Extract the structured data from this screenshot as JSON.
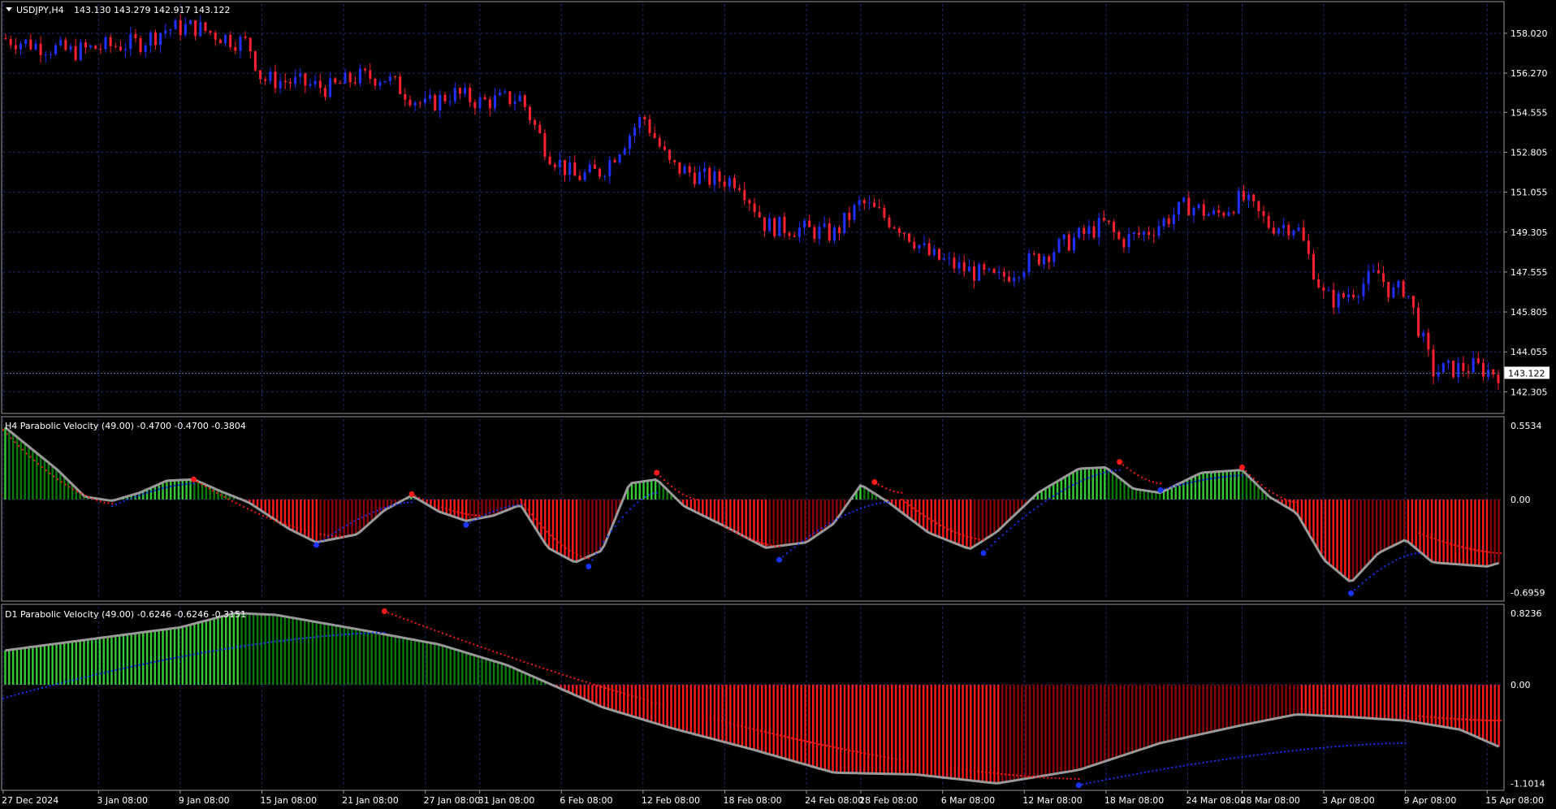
{
  "header": {
    "symbol": "USDJPY,H4",
    "ohlc": "143.130 143.279 142.917 143.122"
  },
  "colors": {
    "background": "#000000",
    "grid": "#1e2c6e",
    "bull_candle": "#2030ff",
    "bear_candle": "#ff2030",
    "hist_green_light": "#33cc33",
    "hist_green_dark": "#0a7a0a",
    "hist_red": "#ff1a1a",
    "hist_red_dark": "#8b0000",
    "velocity_line": "#999999",
    "sar_red": "#ff1a1a",
    "sar_blue": "#1a33ff",
    "price_box_bg": "#ffffff",
    "price_box_text": "#000000"
  },
  "chart_data": [
    {
      "type": "candlestick",
      "title": "USDJPY,H4",
      "ohlc_text": "143.130 143.279 142.917 143.122",
      "ylim": [
        141.5,
        159.3
      ],
      "y_ticks": [
        "158.020",
        "156.270",
        "154.555",
        "152.805",
        "151.055",
        "149.305",
        "147.555",
        "145.805",
        "144.055",
        "142.305"
      ],
      "y_tick_values": [
        158.02,
        156.27,
        154.555,
        152.805,
        151.055,
        149.305,
        147.555,
        145.805,
        144.055,
        142.305
      ],
      "current_price": "143.122",
      "current_price_value": 143.122,
      "close_path": [
        {
          "d": "2024-12-27",
          "v": 157.8
        },
        {
          "d": "2025-01-01",
          "v": 157.2
        },
        {
          "d": "2025-01-03",
          "v": 157.4
        },
        {
          "d": "2025-01-06",
          "v": 157.6
        },
        {
          "d": "2025-01-08",
          "v": 158.2
        },
        {
          "d": "2025-01-10",
          "v": 158.3
        },
        {
          "d": "2025-01-13",
          "v": 157.7
        },
        {
          "d": "2025-01-14",
          "v": 157.6
        },
        {
          "d": "2025-01-15",
          "v": 156.0
        },
        {
          "d": "2025-01-17",
          "v": 155.9
        },
        {
          "d": "2025-01-20",
          "v": 155.6
        },
        {
          "d": "2025-01-22",
          "v": 156.1
        },
        {
          "d": "2025-01-24",
          "v": 156.1
        },
        {
          "d": "2025-01-27",
          "v": 154.8
        },
        {
          "d": "2025-01-29",
          "v": 155.4
        },
        {
          "d": "2025-01-31",
          "v": 155.0
        },
        {
          "d": "2025-02-03",
          "v": 155.2
        },
        {
          "d": "2025-02-05",
          "v": 152.8
        },
        {
          "d": "2025-02-07",
          "v": 151.7
        },
        {
          "d": "2025-02-09",
          "v": 152.0
        },
        {
          "d": "2025-02-12",
          "v": 154.4
        },
        {
          "d": "2025-02-14",
          "v": 152.2
        },
        {
          "d": "2025-02-17",
          "v": 151.6
        },
        {
          "d": "2025-02-19",
          "v": 151.6
        },
        {
          "d": "2025-02-21",
          "v": 149.6
        },
        {
          "d": "2025-02-24",
          "v": 149.4
        },
        {
          "d": "2025-02-26",
          "v": 149.2
        },
        {
          "d": "2025-02-28",
          "v": 150.6
        },
        {
          "d": "2025-03-03",
          "v": 149.5
        },
        {
          "d": "2025-03-05",
          "v": 148.3
        },
        {
          "d": "2025-03-07",
          "v": 147.8
        },
        {
          "d": "2025-03-10",
          "v": 147.2
        },
        {
          "d": "2025-03-12",
          "v": 147.9
        },
        {
          "d": "2025-03-14",
          "v": 148.5
        },
        {
          "d": "2025-03-17",
          "v": 149.4
        },
        {
          "d": "2025-03-18",
          "v": 149.7
        },
        {
          "d": "2025-03-19",
          "v": 148.9
        },
        {
          "d": "2025-03-21",
          "v": 149.3
        },
        {
          "d": "2025-03-24",
          "v": 150.5
        },
        {
          "d": "2025-03-26",
          "v": 150.0
        },
        {
          "d": "2025-03-28",
          "v": 150.8
        },
        {
          "d": "2025-03-30",
          "v": 149.6
        },
        {
          "d": "2025-04-01",
          "v": 149.6
        },
        {
          "d": "2025-04-03",
          "v": 146.5
        },
        {
          "d": "2025-04-04",
          "v": 146.3
        },
        {
          "d": "2025-04-07",
          "v": 147.5
        },
        {
          "d": "2025-04-08",
          "v": 146.6
        },
        {
          "d": "2025-04-09",
          "v": 146.9
        },
        {
          "d": "2025-04-11",
          "v": 143.2
        },
        {
          "d": "2025-04-14",
          "v": 143.4
        },
        {
          "d": "2025-04-16",
          "v": 143.1
        }
      ]
    },
    {
      "type": "bar",
      "title": "H4 Parabolic Velocity (49.00) -0.4700 -0.4700 -0.3804",
      "ylim": [
        -0.74,
        0.6
      ],
      "y_ticks": [
        "0.5534",
        "0.00",
        "-0.6959"
      ],
      "y_tick_values": [
        0.5534,
        0,
        -0.6959
      ],
      "velocity": [
        {
          "d": "2024-12-27",
          "v": 0.55
        },
        {
          "d": "2024-12-31",
          "v": 0.22
        },
        {
          "d": "2025-01-02",
          "v": 0.02
        },
        {
          "d": "2025-01-04",
          "v": -0.01
        },
        {
          "d": "2025-01-06",
          "v": 0.05
        },
        {
          "d": "2025-01-08",
          "v": 0.14
        },
        {
          "d": "2025-01-10",
          "v": 0.15
        },
        {
          "d": "2025-01-12",
          "v": 0.06
        },
        {
          "d": "2025-01-14",
          "v": -0.02
        },
        {
          "d": "2025-01-17",
          "v": -0.22
        },
        {
          "d": "2025-01-19",
          "v": -0.32
        },
        {
          "d": "2025-01-22",
          "v": -0.26
        },
        {
          "d": "2025-01-24",
          "v": -0.08
        },
        {
          "d": "2025-01-26",
          "v": 0.03
        },
        {
          "d": "2025-01-28",
          "v": -0.09
        },
        {
          "d": "2025-01-30",
          "v": -0.16
        },
        {
          "d": "2025-02-01",
          "v": -0.12
        },
        {
          "d": "2025-02-03",
          "v": -0.04
        },
        {
          "d": "2025-02-05",
          "v": -0.36
        },
        {
          "d": "2025-02-07",
          "v": -0.47
        },
        {
          "d": "2025-02-09",
          "v": -0.38
        },
        {
          "d": "2025-02-11",
          "v": 0.12
        },
        {
          "d": "2025-02-13",
          "v": 0.15
        },
        {
          "d": "2025-02-15",
          "v": -0.05
        },
        {
          "d": "2025-02-18",
          "v": -0.2
        },
        {
          "d": "2025-02-21",
          "v": -0.36
        },
        {
          "d": "2025-02-24",
          "v": -0.32
        },
        {
          "d": "2025-02-26",
          "v": -0.18
        },
        {
          "d": "2025-02-28",
          "v": 0.11
        },
        {
          "d": "2025-03-02",
          "v": -0.02
        },
        {
          "d": "2025-03-05",
          "v": -0.25
        },
        {
          "d": "2025-03-08",
          "v": -0.37
        },
        {
          "d": "2025-03-10",
          "v": -0.24
        },
        {
          "d": "2025-03-13",
          "v": 0.05
        },
        {
          "d": "2025-03-16",
          "v": 0.23
        },
        {
          "d": "2025-03-18",
          "v": 0.24
        },
        {
          "d": "2025-03-20",
          "v": 0.08
        },
        {
          "d": "2025-03-22",
          "v": 0.05
        },
        {
          "d": "2025-03-25",
          "v": 0.2
        },
        {
          "d": "2025-03-28",
          "v": 0.22
        },
        {
          "d": "2025-03-30",
          "v": 0.02
        },
        {
          "d": "2025-04-01",
          "v": -0.1
        },
        {
          "d": "2025-04-03",
          "v": -0.45
        },
        {
          "d": "2025-04-05",
          "v": -0.62
        },
        {
          "d": "2025-04-07",
          "v": -0.4
        },
        {
          "d": "2025-04-09",
          "v": -0.3
        },
        {
          "d": "2025-04-11",
          "v": -0.47
        },
        {
          "d": "2025-04-15",
          "v": -0.5
        },
        {
          "d": "2025-04-16",
          "v": -0.47
        }
      ],
      "sar": [
        {
          "from": "2024-12-27",
          "to": "2025-01-04",
          "v0": 0.52,
          "v1": -0.03,
          "color": "red"
        },
        {
          "from": "2025-01-04",
          "to": "2025-01-10",
          "v0": -0.05,
          "v1": 0.12,
          "color": "blue"
        },
        {
          "from": "2025-01-10",
          "to": "2025-01-21",
          "v0": 0.15,
          "v1": -0.28,
          "color": "red"
        },
        {
          "from": "2025-01-19",
          "to": "2025-01-26",
          "v0": -0.34,
          "v1": -0.02,
          "color": "blue"
        },
        {
          "from": "2025-01-26",
          "to": "2025-01-31",
          "v0": 0.04,
          "v1": -0.12,
          "color": "red"
        },
        {
          "from": "2025-01-30",
          "to": "2025-02-03",
          "v0": -0.19,
          "v1": -0.04,
          "color": "blue"
        },
        {
          "from": "2025-02-03",
          "to": "2025-02-08",
          "v0": 0.0,
          "v1": -0.44,
          "color": "red"
        },
        {
          "from": "2025-02-08",
          "to": "2025-02-13",
          "v0": -0.5,
          "v1": 0.05,
          "color": "blue"
        },
        {
          "from": "2025-02-13",
          "to": "2025-02-16",
          "v0": 0.2,
          "v1": 0.0,
          "color": "red"
        },
        {
          "from": "2025-02-18",
          "to": "2025-02-22",
          "v0": -0.2,
          "v1": -0.35,
          "color": "red"
        },
        {
          "from": "2025-02-22",
          "to": "2025-03-02",
          "v0": -0.45,
          "v1": -0.02,
          "color": "blue"
        },
        {
          "from": "2025-03-01",
          "to": "2025-03-03",
          "v0": 0.13,
          "v1": 0.05,
          "color": "red"
        },
        {
          "from": "2025-03-03",
          "to": "2025-03-09",
          "v0": 0.0,
          "v1": -0.3,
          "color": "red"
        },
        {
          "from": "2025-03-09",
          "to": "2025-03-19",
          "v0": -0.4,
          "v1": 0.22,
          "color": "blue"
        },
        {
          "from": "2025-03-19",
          "to": "2025-03-22",
          "v0": 0.28,
          "v1": 0.12,
          "color": "red"
        },
        {
          "from": "2025-03-22",
          "to": "2025-03-28",
          "v0": 0.07,
          "v1": 0.18,
          "color": "blue"
        },
        {
          "from": "2025-03-28",
          "to": "2025-04-01",
          "v0": 0.24,
          "v1": -0.02,
          "color": "red"
        },
        {
          "from": "2025-04-05",
          "to": "2025-04-10",
          "v0": -0.7,
          "v1": -0.4,
          "color": "blue"
        },
        {
          "from": "2025-04-10",
          "to": "2025-04-16",
          "v0": -0.25,
          "v1": -0.4,
          "color": "red"
        }
      ],
      "sar_dots": [
        {
          "d": "2025-01-10",
          "v": 0.15,
          "color": "red"
        },
        {
          "d": "2025-01-19",
          "v": -0.34,
          "color": "blue"
        },
        {
          "d": "2025-01-26",
          "v": 0.04,
          "color": "red"
        },
        {
          "d": "2025-01-30",
          "v": -0.19,
          "color": "blue"
        },
        {
          "d": "2025-02-08",
          "v": -0.5,
          "color": "blue"
        },
        {
          "d": "2025-02-13",
          "v": 0.2,
          "color": "red"
        },
        {
          "d": "2025-02-22",
          "v": -0.45,
          "color": "blue"
        },
        {
          "d": "2025-03-01",
          "v": 0.13,
          "color": "red"
        },
        {
          "d": "2025-03-09",
          "v": -0.4,
          "color": "blue"
        },
        {
          "d": "2025-03-19",
          "v": 0.28,
          "color": "red"
        },
        {
          "d": "2025-03-22",
          "v": 0.07,
          "color": "blue"
        },
        {
          "d": "2025-03-28",
          "v": 0.24,
          "color": "red"
        },
        {
          "d": "2025-04-05",
          "v": -0.7,
          "color": "blue"
        }
      ]
    },
    {
      "type": "bar",
      "title": "D1 Parabolic Velocity (49.00) -0.6246 -0.6246 -0.3151",
      "ylim": [
        -1.15,
        0.87
      ],
      "y_ticks": [
        "0.8236",
        "0.00",
        "-1.1014"
      ],
      "y_tick_values": [
        0.8236,
        0,
        -1.1014
      ],
      "velocity": [
        {
          "d": "2024-12-27",
          "v": 0.38
        },
        {
          "d": "2025-01-03",
          "v": 0.52
        },
        {
          "d": "2025-01-09",
          "v": 0.64
        },
        {
          "d": "2025-01-13",
          "v": 0.8
        },
        {
          "d": "2025-01-16",
          "v": 0.78
        },
        {
          "d": "2025-01-22",
          "v": 0.62
        },
        {
          "d": "2025-01-28",
          "v": 0.45
        },
        {
          "d": "2025-02-02",
          "v": 0.22
        },
        {
          "d": "2025-02-05",
          "v": 0.02
        },
        {
          "d": "2025-02-09",
          "v": -0.25
        },
        {
          "d": "2025-02-14",
          "v": -0.48
        },
        {
          "d": "2025-02-20",
          "v": -0.72
        },
        {
          "d": "2025-02-26",
          "v": -0.98
        },
        {
          "d": "2025-03-04",
          "v": -1.0
        },
        {
          "d": "2025-03-10",
          "v": -1.1
        },
        {
          "d": "2025-03-16",
          "v": -0.95
        },
        {
          "d": "2025-03-22",
          "v": -0.65
        },
        {
          "d": "2025-03-28",
          "v": -0.45
        },
        {
          "d": "2025-04-01",
          "v": -0.33
        },
        {
          "d": "2025-04-05",
          "v": -0.36
        },
        {
          "d": "2025-04-09",
          "v": -0.4
        },
        {
          "d": "2025-04-13",
          "v": -0.5
        },
        {
          "d": "2025-04-16",
          "v": -0.7
        }
      ],
      "sar": [
        {
          "from": "2024-12-27",
          "to": "2025-01-24",
          "v0": -0.15,
          "v1": 0.58,
          "color": "blue"
        },
        {
          "from": "2025-01-24",
          "to": "2025-03-16",
          "v0": 0.82,
          "v1": -1.05,
          "color": "red"
        },
        {
          "from": "2025-03-16",
          "to": "2025-04-09",
          "v0": -1.12,
          "v1": -0.65,
          "color": "blue"
        },
        {
          "from": "2025-04-10",
          "to": "2025-04-16",
          "v0": -0.35,
          "v1": -0.4,
          "color": "red"
        }
      ],
      "sar_dots": [
        {
          "d": "2025-01-24",
          "v": 0.82,
          "color": "red"
        },
        {
          "d": "2025-03-16",
          "v": -1.12,
          "color": "blue"
        }
      ]
    }
  ],
  "x_axis": {
    "labels": [
      "27 Dec 2024",
      "3 Jan 08:00",
      "9 Jan 08:00",
      "15 Jan 08:00",
      "21 Jan 08:00",
      "27 Jan 08:00",
      "31 Jan 08:00",
      "6 Feb 08:00",
      "12 Feb 08:00",
      "18 Feb 08:00",
      "24 Feb 08:00",
      "28 Feb 08:00",
      "6 Mar 08:00",
      "12 Mar 08:00",
      "18 Mar 08:00",
      "24 Mar 08:00",
      "28 Mar 08:00",
      "3 Apr 08:00",
      "9 Apr 08:00",
      "15 Apr 08:00"
    ],
    "dates": [
      "2024-12-27",
      "2025-01-03",
      "2025-01-09",
      "2025-01-15",
      "2025-01-21",
      "2025-01-27",
      "2025-01-31",
      "2025-02-06",
      "2025-02-12",
      "2025-02-18",
      "2025-02-24",
      "2025-02-28",
      "2025-03-06",
      "2025-03-12",
      "2025-03-18",
      "2025-03-24",
      "2025-03-28",
      "2025-04-03",
      "2025-04-09",
      "2025-04-15"
    ]
  }
}
